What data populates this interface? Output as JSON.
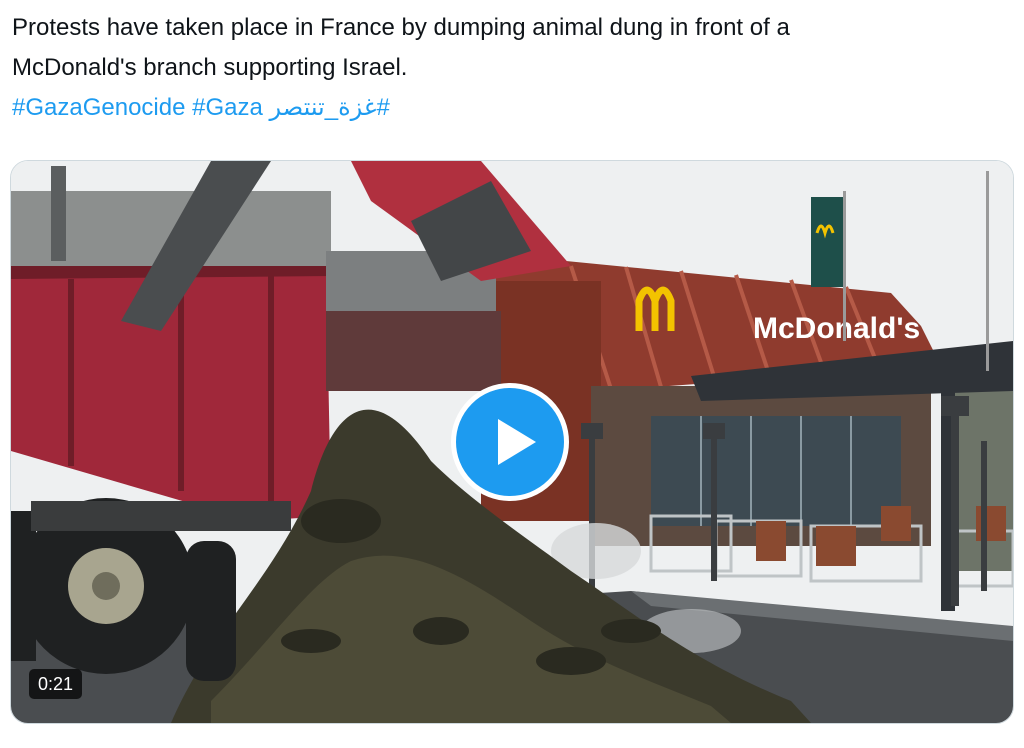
{
  "tweet": {
    "text_line1": "Protests have taken place in France by dumping animal dung in front of a",
    "text_line2": "McDonald's branch supporting Israel.",
    "hashtags": [
      "#GazaGenocide",
      "#Gaza",
      "#غزة_تنتصر"
    ]
  },
  "video": {
    "duration": "0:21",
    "sign_text": "McDonald's",
    "play_icon": "play-icon",
    "accent_color": "#1d9bf0"
  }
}
